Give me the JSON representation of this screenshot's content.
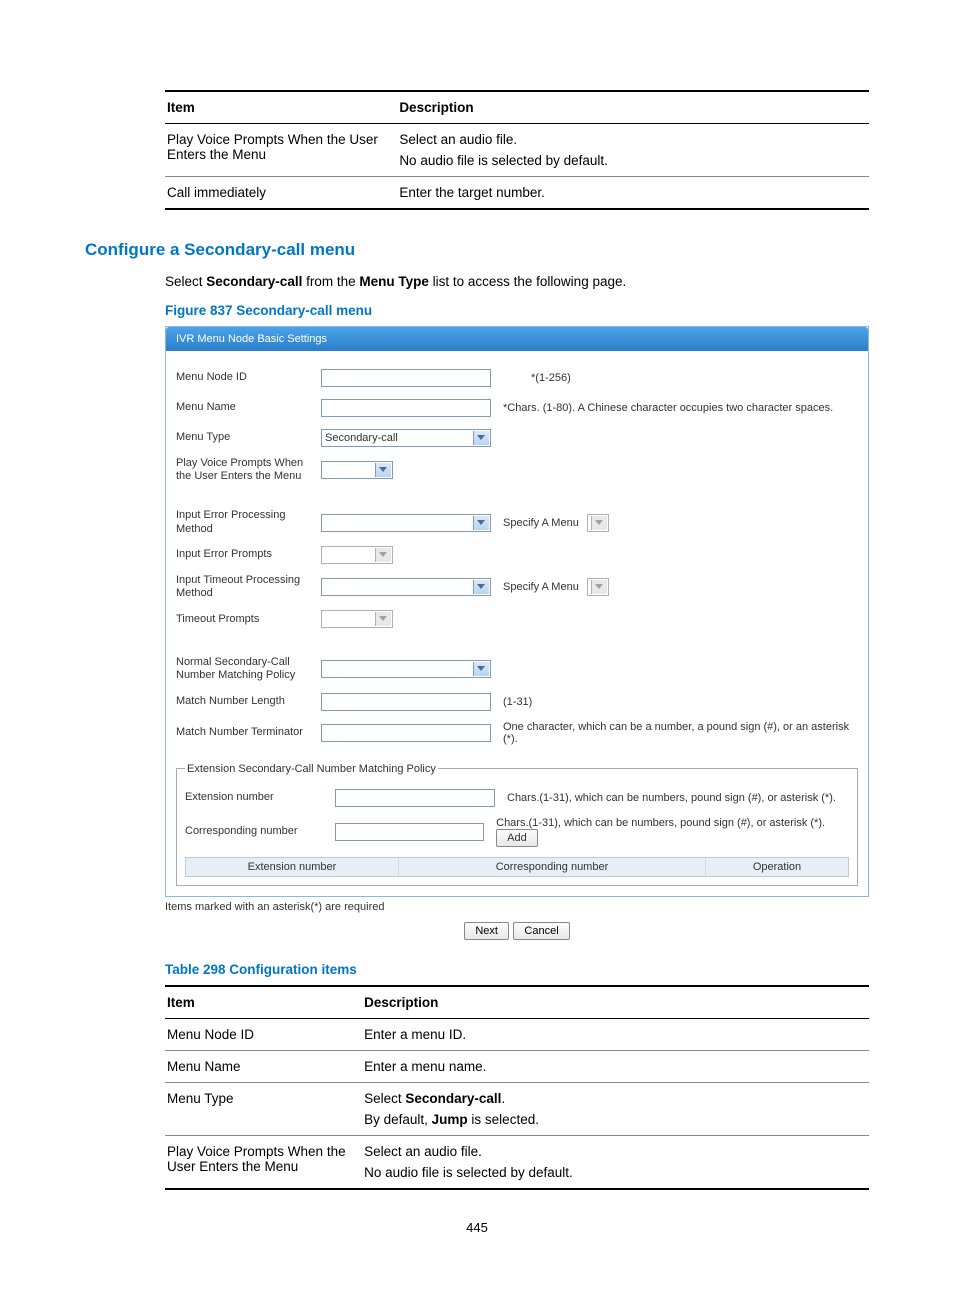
{
  "table1": {
    "head": {
      "item": "Item",
      "desc": "Description"
    },
    "rows": [
      {
        "item": "Play Voice Prompts When the User Enters the Menu",
        "desc_l1": "Select an audio file.",
        "desc_l2": "No audio file is selected by default."
      },
      {
        "item": "Call immediately",
        "desc_l1": "Enter the target number.",
        "desc_l2": ""
      }
    ]
  },
  "h2": "Configure a Secondary-call menu",
  "intro": {
    "pre": "Select ",
    "b1": "Secondary-call",
    "mid": " from the ",
    "b2": "Menu Type",
    "post": " list to access the following page."
  },
  "figcap": "Figure 837 Secondary-call menu",
  "panel": {
    "title": "IVR Menu Node Basic Settings",
    "labels": {
      "menu_node_id": "Menu Node ID",
      "menu_name": "Menu Name",
      "menu_type": "Menu Type",
      "play_prompts": "Play Voice Prompts When the User Enters the Menu",
      "input_err_method": "Input Error Processing Method",
      "input_err_prompts": "Input Error Prompts",
      "input_to_method": "Input Timeout Processing Method",
      "timeout_prompts": "Timeout Prompts",
      "normal_policy": "Normal Secondary-Call Number Matching Policy",
      "match_len": "Match Number Length",
      "match_term": "Match Number Terminator",
      "ext_number": "Extension number",
      "corr_number": "Corresponding number"
    },
    "values": {
      "menu_type": "Secondary-call",
      "specify_menu": "Specify A Menu"
    },
    "hints": {
      "menu_node_id": "*(1-256)",
      "menu_name": "*Chars. (1-80). A Chinese character occupies two character spaces.",
      "match_len": "(1-31)",
      "match_term": "One character, which can be a number, a pound sign (#), or an asterisk (*).",
      "ext_number": "Chars.(1-31), which can be numbers, pound sign (#), or asterisk (*).",
      "corr_number": "Chars.(1-31), which can be numbers, pound sign (#), or asterisk (*)."
    },
    "fieldset_legend": "Extension Secondary-Call Number Matching Policy",
    "add_btn": "Add",
    "grid": {
      "c1": "Extension number",
      "c2": "Corresponding number",
      "c3": "Operation"
    }
  },
  "footnote": "Items marked with an asterisk(*) are required",
  "buttons": {
    "next": "Next",
    "cancel": "Cancel"
  },
  "tblcap": "Table 298 Configuration items",
  "table2": {
    "head": {
      "item": "Item",
      "desc": "Description"
    },
    "r1": {
      "item": "Menu Node ID",
      "desc": "Enter a menu ID."
    },
    "r2": {
      "item": "Menu Name",
      "desc": "Enter a menu name."
    },
    "r3": {
      "item": "Menu Type",
      "l1a": "Select ",
      "l1b": "Secondary-call",
      "l1c": ".",
      "l2a": "By default, ",
      "l2b": "Jump",
      "l2c": " is selected."
    },
    "r4": {
      "item": "Play Voice Prompts When the User Enters the Menu",
      "l1": "Select an audio file.",
      "l2": "No audio file is selected by default."
    }
  },
  "page_number": "445"
}
